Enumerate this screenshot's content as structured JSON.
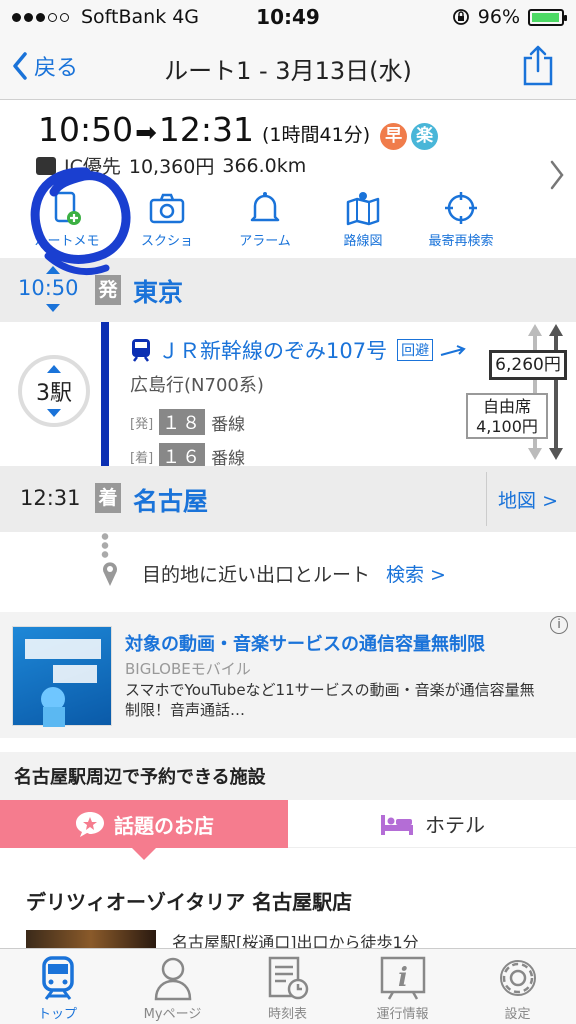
{
  "status_bar": {
    "carrier": "SoftBank",
    "network": "4G",
    "time": "10:49",
    "battery": "96%",
    "battery_level": 0.96
  },
  "nav": {
    "back_label": "戻る",
    "title": "ルート1 - 3月13日(水)"
  },
  "summary": {
    "depart": "10:50",
    "arrive": "12:31",
    "duration": "(1時間41分)",
    "badges": [
      "早",
      "楽"
    ],
    "fare_label": "IC優先",
    "fare": "10,360円",
    "distance": "366.0km"
  },
  "tools": [
    {
      "label": "ルートメモ",
      "icon": "memo-add-icon"
    },
    {
      "label": "スクショ",
      "icon": "camera-icon"
    },
    {
      "label": "アラーム",
      "icon": "bell-icon"
    },
    {
      "label": "路線図",
      "icon": "map-icon"
    },
    {
      "label": "最寄再検索",
      "icon": "target-icon"
    }
  ],
  "route": {
    "from": {
      "time": "10:50",
      "mark": "発",
      "station": "東京"
    },
    "stops_count": "3駅",
    "train": {
      "name": "ＪＲ新幹線のぞみ107号",
      "detour": "回避",
      "dest": "広島行(N700系)"
    },
    "platform_dep": {
      "tag": "[発]",
      "num": "１８",
      "suffix": "番線"
    },
    "platform_arr": {
      "tag": "[着]",
      "num": "１６",
      "suffix": "番線"
    },
    "fare_total": "6,260円",
    "seat_type": "自由席",
    "seat_fare": "4,100円",
    "to": {
      "time": "12:31",
      "mark": "着",
      "station": "名古屋"
    },
    "map_link": "地図 >",
    "exit_text": "目的地に近い出口とルート",
    "exit_search": "検索 >"
  },
  "ad": {
    "title": "対象の動画・音楽サービスの通信容量無制限",
    "sponsor": "BIGLOBEモバイル",
    "body": "スマホでYouTubeなど11サービスの動画・音楽が通信容量無制限！音声通話…",
    "info": "i"
  },
  "facilities": {
    "heading": "名古屋駅周辺で予約できる施設",
    "tab_active": "話題のお店",
    "tab_inactive": "ホテル",
    "shop_name": "デリツィオーゾイタリア 名古屋駅店",
    "shop_access": "名古屋駅[桜通口]出口から徒歩1分"
  },
  "tabbar": [
    {
      "label": "トップ",
      "icon": "train-icon",
      "active": true
    },
    {
      "label": "Myページ",
      "icon": "person-icon",
      "active": false
    },
    {
      "label": "時刻表",
      "icon": "timetable-icon",
      "active": false
    },
    {
      "label": "運行情報",
      "icon": "info-icon",
      "active": false
    },
    {
      "label": "設定",
      "icon": "gear-icon",
      "active": false
    }
  ],
  "colors": {
    "accent": "#1a73d9",
    "line": "#0b2fb3",
    "pink": "#f57c8e",
    "annotation": "#1a3fd0"
  }
}
